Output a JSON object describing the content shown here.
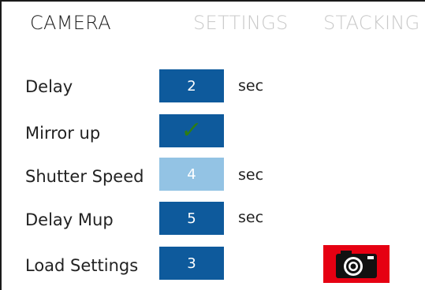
{
  "tabs": [
    {
      "label": "CAMERA",
      "active": true
    },
    {
      "label": "SETTINGS",
      "active": false
    },
    {
      "label": "STACKING",
      "active": false
    }
  ],
  "rows": {
    "delay": {
      "label": "Delay",
      "value": "2",
      "unit": "sec",
      "state": "normal"
    },
    "mirror_up": {
      "label": "Mirror up",
      "value_icon": "checkmark-icon",
      "checked": true,
      "state": "normal"
    },
    "shutter_speed": {
      "label": "Shutter Speed",
      "value": "4",
      "unit": "sec",
      "state": "selected"
    },
    "delay_mup": {
      "label": "Delay Mup",
      "value": "5",
      "unit": "sec",
      "state": "normal"
    },
    "load_settings": {
      "label": "Load Settings",
      "value": "3",
      "state": "normal"
    }
  },
  "camera_button": {
    "icon": "camera-icon"
  },
  "colors": {
    "box_normal": "#0e5a9c",
    "box_selected": "#93c3e4",
    "camera_button_bg": "#e60012",
    "tab_active": "#1e1e1e",
    "tab_inactive": "#c9c9c9",
    "check_green": "#2f7d12"
  }
}
